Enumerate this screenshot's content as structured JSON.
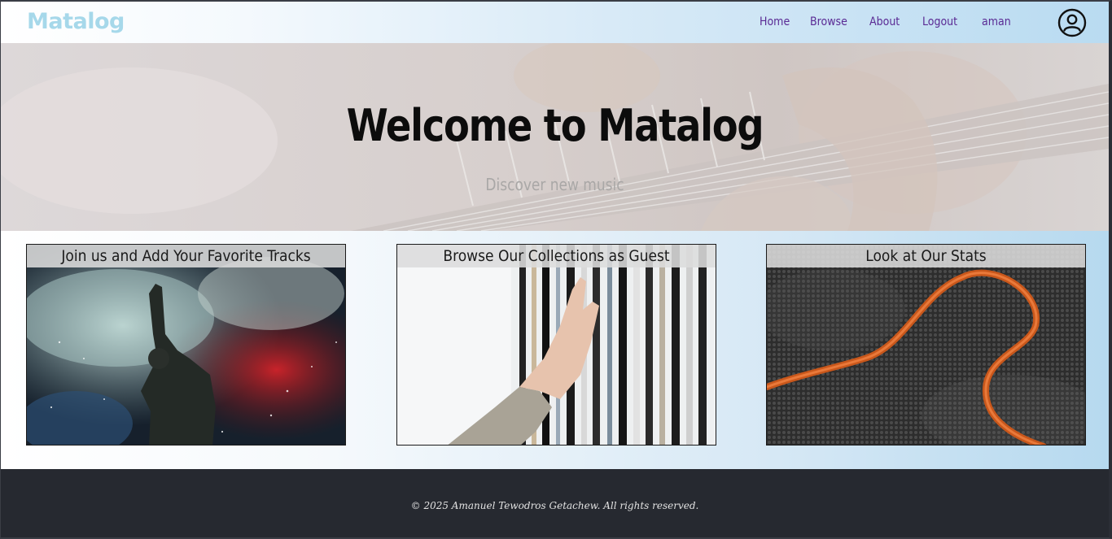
{
  "header": {
    "brand": "Matalog",
    "nav": [
      {
        "label": "Home"
      },
      {
        "label": "Browse"
      },
      {
        "label": "About"
      },
      {
        "label": "Logout"
      },
      {
        "label": "aman"
      }
    ],
    "profile_icon": "user-circle-icon"
  },
  "hero": {
    "title": "Welcome to Matalog",
    "subtitle": "Discover new music"
  },
  "cards": [
    {
      "title": "Join us and Add Your Favorite Tracks"
    },
    {
      "title": "Browse Our Collections as Guest"
    },
    {
      "title": "Look at Our Stats"
    }
  ],
  "footer": {
    "copyright": "© 2025 Amanuel Tewodros Getachew. All rights reserved."
  },
  "colors": {
    "brand": "#a6d8ea",
    "nav_link": "#5a2a94",
    "footer_bg": "#262930"
  }
}
